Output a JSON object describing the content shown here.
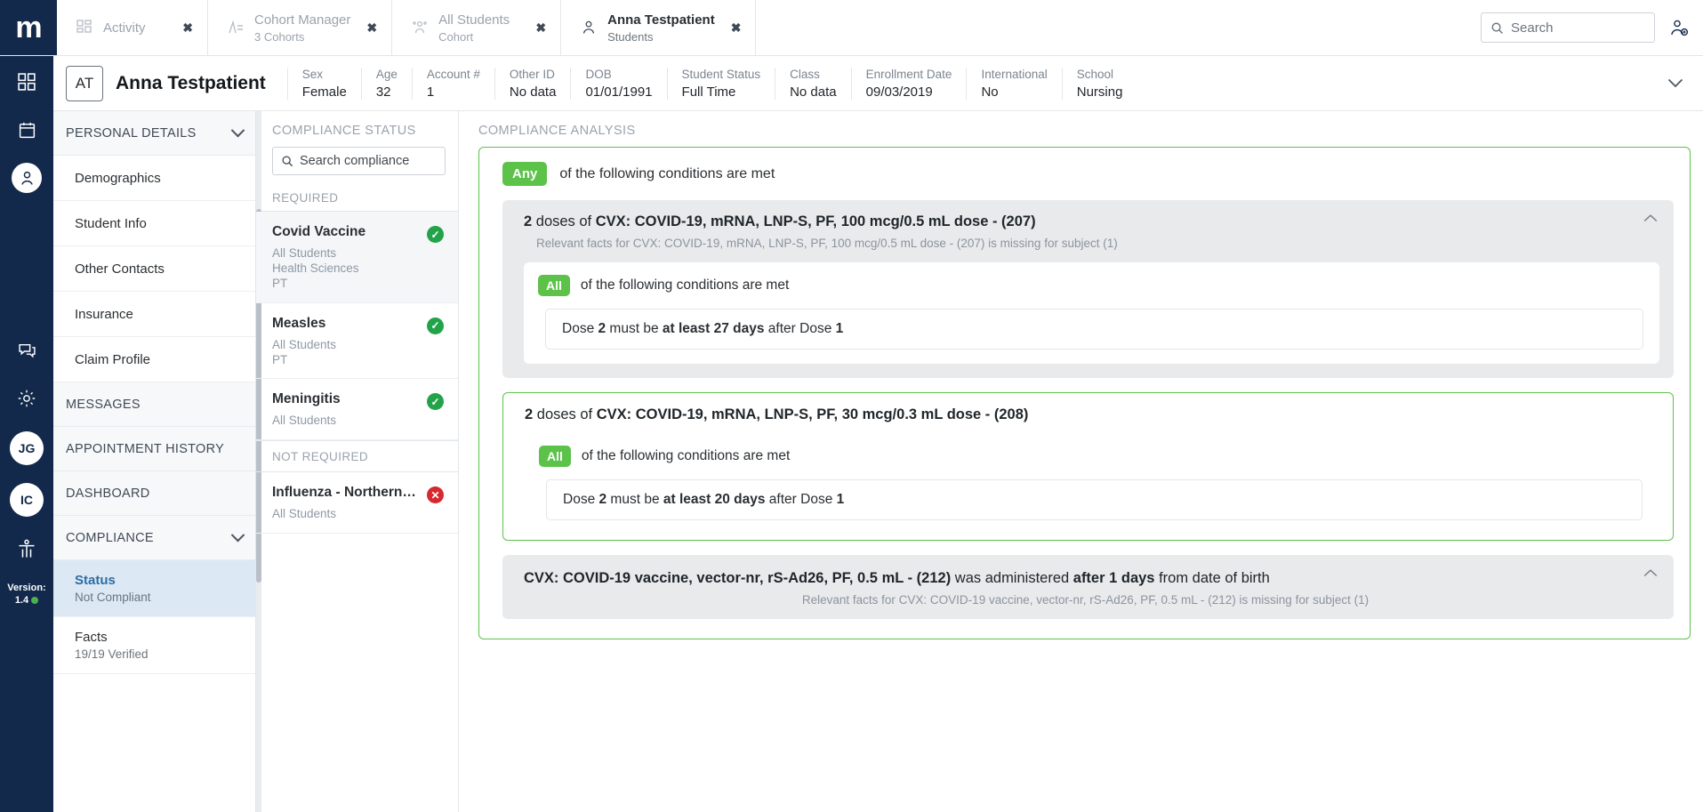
{
  "topbar": {
    "logo": "m",
    "tabs": [
      {
        "title": "Activity",
        "sub": "",
        "icon": "activity-grid-icon",
        "close": "✖",
        "active": false
      },
      {
        "title": "Cohort Manager",
        "sub": "3 Cohorts",
        "icon": "cohort-chart-icon",
        "close": "✖",
        "active": false
      },
      {
        "title": "All Students",
        "sub": "Cohort",
        "icon": "students-group-icon",
        "close": "✖",
        "active": false
      },
      {
        "title": "Anna Testpatient",
        "sub": "Students",
        "icon": "person-icon",
        "close": "✖",
        "active": true
      }
    ],
    "search_placeholder": "Search",
    "user_icon": "user-add-icon"
  },
  "rail": {
    "items": [
      {
        "icon": "dashboard-grid-icon",
        "type": "icon"
      },
      {
        "icon": "calendar-icon",
        "type": "icon"
      },
      {
        "icon": "person-icon",
        "type": "icon-circled"
      },
      {
        "icon": "messages-icon",
        "type": "icon"
      },
      {
        "icon": "gear-icon",
        "type": "icon"
      },
      {
        "label": "JG",
        "type": "avatar"
      },
      {
        "label": "IC",
        "type": "avatar"
      },
      {
        "icon": "accessibility-icon",
        "type": "icon"
      }
    ],
    "version_label": "Version:",
    "version_value": "1.4"
  },
  "patient": {
    "initials": "AT",
    "name": "Anna Testpatient",
    "fields": [
      {
        "label": "Sex",
        "value": "Female"
      },
      {
        "label": "Age",
        "value": "32"
      },
      {
        "label": "Account #",
        "value": "1"
      },
      {
        "label": "Other ID",
        "value": "No data"
      },
      {
        "label": "DOB",
        "value": "01/01/1991"
      },
      {
        "label": "Student Status",
        "value": "Full Time"
      },
      {
        "label": "Class",
        "value": "No data"
      },
      {
        "label": "Enrollment Date",
        "value": "09/03/2019"
      },
      {
        "label": "International",
        "value": "No"
      },
      {
        "label": "School",
        "value": "Nursing"
      }
    ],
    "expand_icon": "chevron-down-icon"
  },
  "leftnav": {
    "sections": [
      {
        "label": "PERSONAL DETAILS",
        "caret": "chevron-down-icon"
      }
    ],
    "personal_items": [
      {
        "label": "Demographics"
      },
      {
        "label": "Student Info"
      },
      {
        "label": "Other Contacts"
      },
      {
        "label": "Insurance"
      },
      {
        "label": "Claim Profile"
      }
    ],
    "messages": "MESSAGES",
    "appointment_history": "APPOINTMENT HISTORY",
    "dashboard": "DASHBOARD",
    "compliance": "COMPLIANCE",
    "compliance_items": [
      {
        "label": "Status",
        "sub": "Not Compliant",
        "selected": true
      },
      {
        "label": "Facts",
        "sub": "19/19   Verified",
        "selected": false
      }
    ]
  },
  "compliance_pane": {
    "title": "COMPLIANCE STATUS",
    "search_placeholder": "Search compliance",
    "groups": [
      {
        "header": "REQUIRED",
        "rows": [
          {
            "name": "Covid Vaccine",
            "tags": [
              "All Students",
              "Health Sciences",
              "PT"
            ],
            "status": "ok",
            "status_glyph": "✓",
            "selected": true
          },
          {
            "name": "Measles",
            "tags": [
              "All Students",
              "PT"
            ],
            "status": "ok",
            "status_glyph": "✓",
            "selected": false
          },
          {
            "name": "Meningitis",
            "tags": [
              "All Students"
            ],
            "status": "ok",
            "status_glyph": "✓",
            "selected": false
          }
        ]
      },
      {
        "header": "NOT REQUIRED",
        "rows": [
          {
            "name": "Influenza - Northern …",
            "tags": [
              "All Students"
            ],
            "status": "no",
            "status_glyph": "✕",
            "selected": false
          }
        ]
      }
    ]
  },
  "analysis": {
    "title": "COMPLIANCE ANALYSIS",
    "root": {
      "chip": "Any",
      "text": "of the following conditions are met"
    },
    "conditions": [
      {
        "style": "grey",
        "prefix_num": "2",
        "prefix_text": " doses of ",
        "strong": "CVX: COVID-19, mRNA, LNP-S, PF, 100 mcg/0.5 mL dose - (207)",
        "sub": "Relevant facts for CVX: COVID-19, mRNA, LNP-S, PF, 100 mcg/0.5 mL dose - (207) is missing for subject (1)",
        "collapse_icon": "chevron-up-icon",
        "inner": {
          "boxed": true,
          "chip": "All",
          "text": "of the following conditions are met",
          "rules": [
            {
              "p1": "Dose ",
              "n1": "2",
              "p2": " must be ",
              "strong": "at least ",
              "n2": "27",
              "strong2": " days",
              "p3": " after Dose ",
              "n3": "1"
            }
          ]
        }
      },
      {
        "style": "outline",
        "prefix_num": "2",
        "prefix_text": " doses of ",
        "strong": "CVX: COVID-19, mRNA, LNP-S, PF, 30 mcg/0.3 mL dose - (208)",
        "sub": "",
        "collapse_icon": "",
        "inner": {
          "boxed": false,
          "chip": "All",
          "text": "of the following conditions are met",
          "rules": [
            {
              "p1": "Dose ",
              "n1": "2",
              "p2": " must be ",
              "strong": "at least ",
              "n2": "20",
              "strong2": " days",
              "p3": " after Dose ",
              "n3": "1"
            }
          ]
        }
      }
    ],
    "flat_row": {
      "strong": "CVX: COVID-19 vaccine, vector-nr, rS-Ad26, PF, 0.5 mL - (212)",
      "mid": " was administered ",
      "strong2": "after  1  days",
      "tail": " from date of birth",
      "sub": "Relevant facts for CVX: COVID-19 vaccine, vector-nr, rS-Ad26, PF, 0.5 mL - (212) is missing for subject (1)",
      "collapse_icon": "chevron-up-icon"
    }
  }
}
